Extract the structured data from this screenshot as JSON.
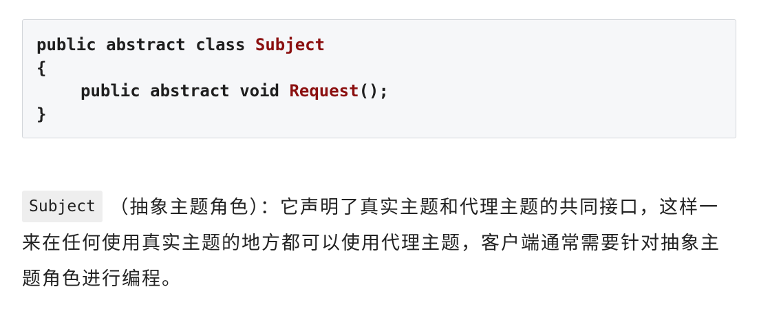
{
  "code": {
    "line1": {
      "keywords": "public abstract class ",
      "class_name": "Subject"
    },
    "line2": "{",
    "line3": {
      "keywords": "public abstract void ",
      "method_name": "Request",
      "suffix": "();"
    },
    "line4": "}"
  },
  "paragraph": {
    "inline_code": "Subject",
    "text": " （抽象主题角色）：它声明了真实主题和代理主题的共同接口，这样一来在任何使用真实主题的地方都可以使用代理主题，客户端通常需要针对抽象主题角色进行编程。"
  }
}
